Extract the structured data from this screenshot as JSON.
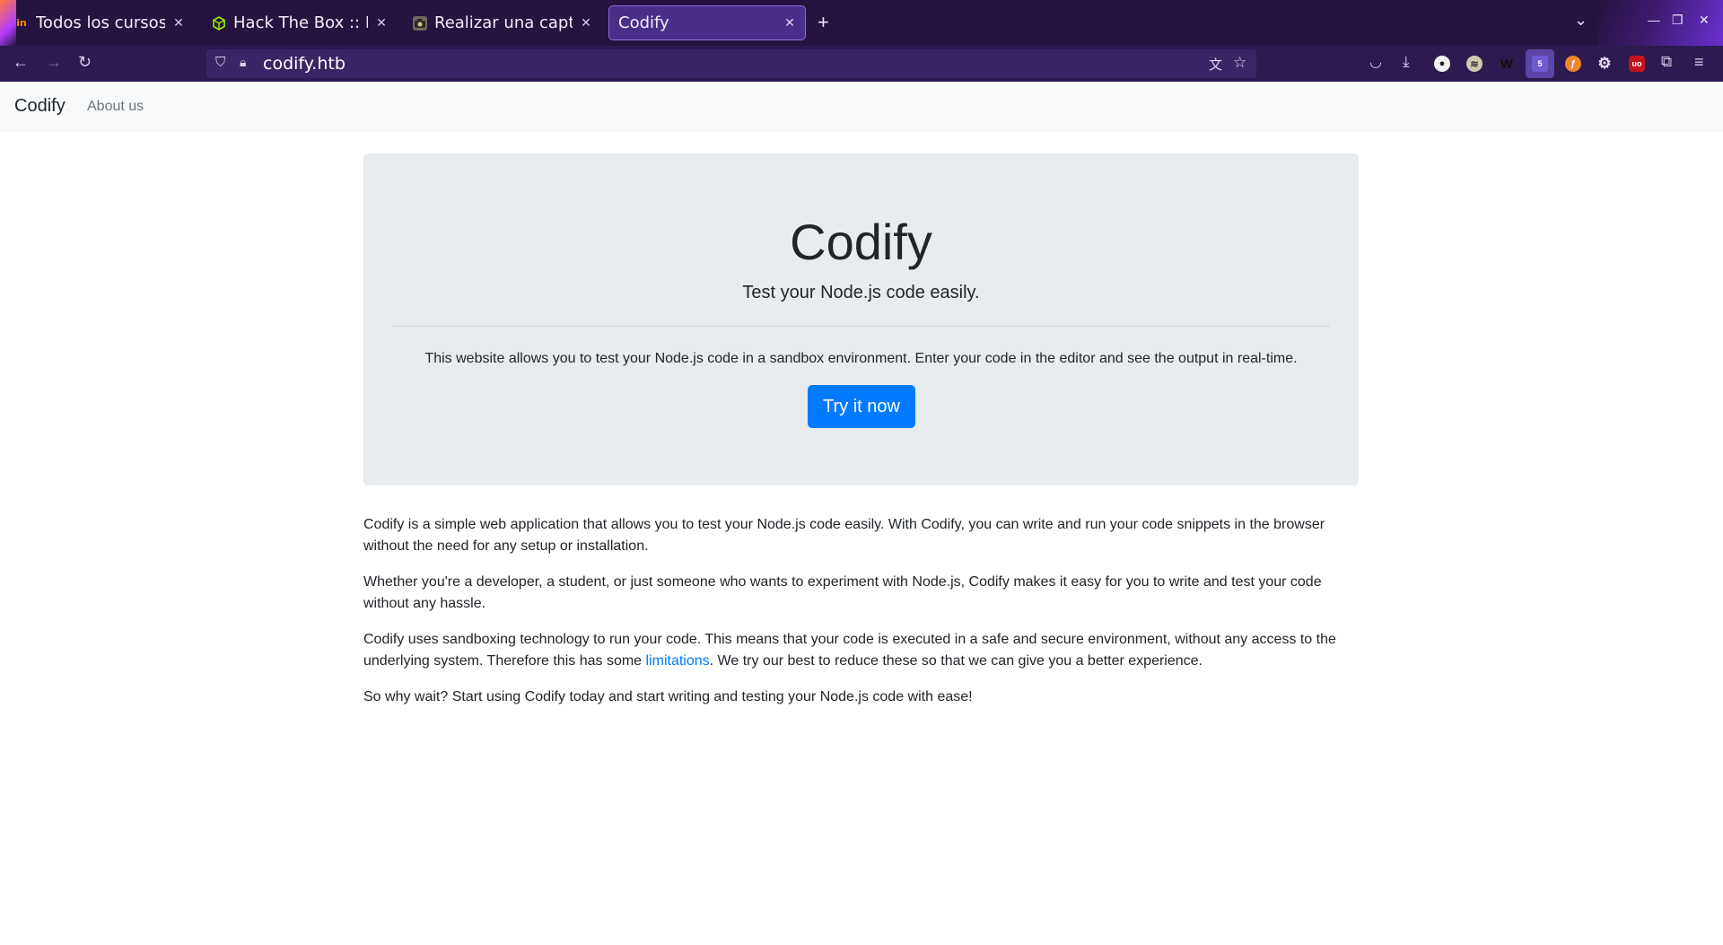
{
  "browser": {
    "tabs": [
      {
        "title": "Todos los cursos | Ed",
        "favicon": "in-logo-icon",
        "active": false
      },
      {
        "title": "Hack The Box :: Hac",
        "favicon": "htb-cube-icon",
        "active": false
      },
      {
        "title": "Realizar una captur",
        "favicon": "camera-icon",
        "active": false
      },
      {
        "title": "Codify",
        "favicon": "",
        "active": true
      }
    ],
    "url": "codify.htb",
    "ext_badge": "5"
  },
  "site": {
    "brand": "Codify",
    "nav_about": "About us"
  },
  "hero": {
    "title": "Codify",
    "lead": "Test your Node.js code easily.",
    "description": "This website allows you to test your Node.js code in a sandbox environment. Enter your code in the editor and see the output in real-time.",
    "button": "Try it now"
  },
  "content": {
    "p1": "Codify is a simple web application that allows you to test your Node.js code easily. With Codify, you can write and run your code snippets in the browser without the need for any setup or installation.",
    "p2": "Whether you're a developer, a student, or just someone who wants to experiment with Node.js, Codify makes it easy for you to write and test your code without any hassle.",
    "p3_before": "Codify uses sandboxing technology to run your code. This means that your code is executed in a safe and secure environment, without any access to the underlying system. Therefore this has some ",
    "p3_link": "limitations",
    "p3_after": ". We try our best to reduce these so that we can give you a better experience.",
    "p4": "So why wait? Start using Codify today and start writing and testing your Node.js code with ease!"
  },
  "colors": {
    "primary": "#007bff",
    "jumbotron_bg": "#e9ecef",
    "navbar_bg": "#f8f9fa",
    "chrome_bg": "#24143f"
  }
}
